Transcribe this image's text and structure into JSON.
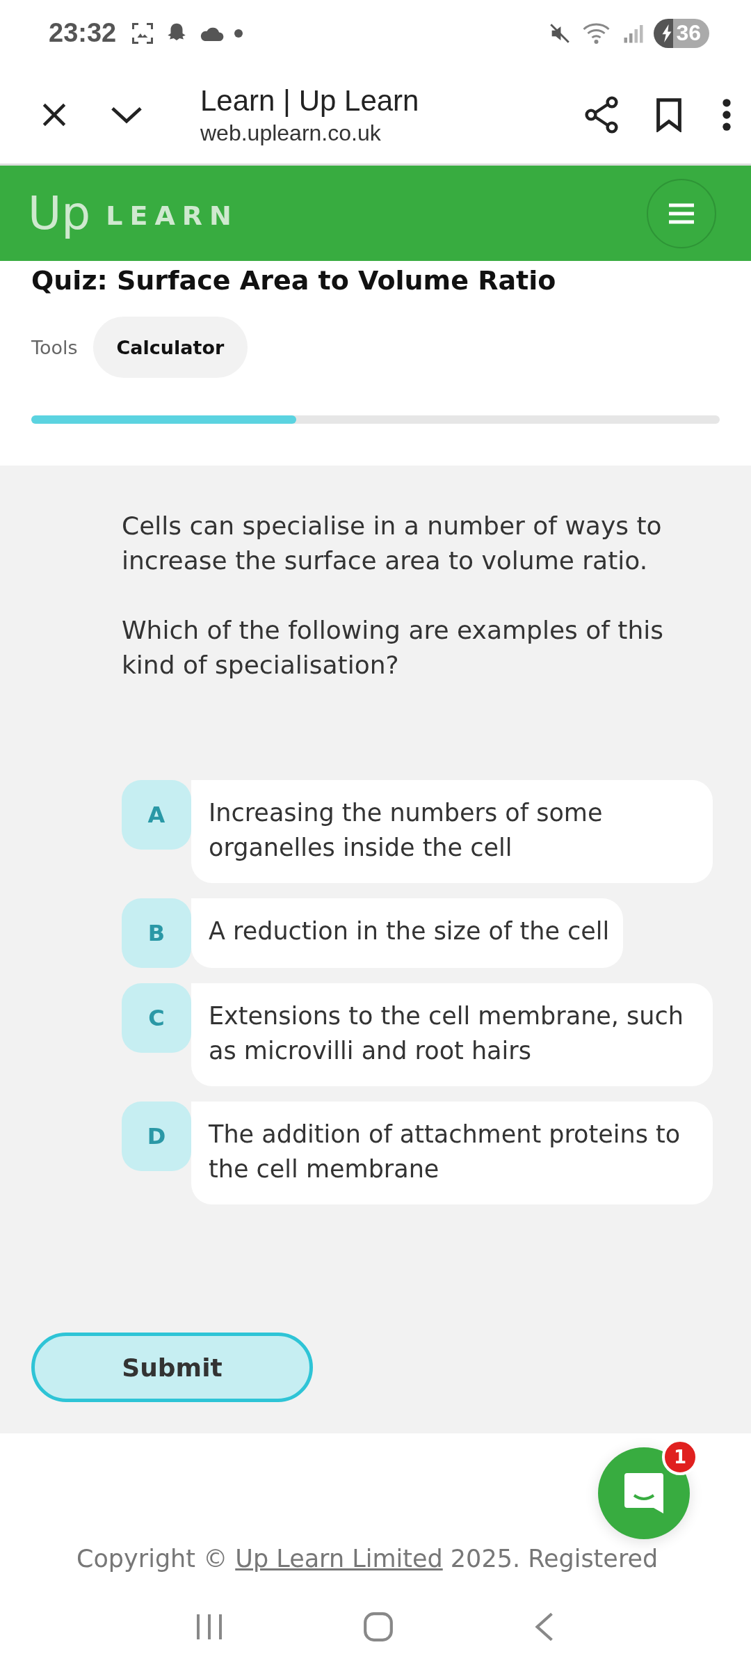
{
  "status_bar": {
    "time": "23:32",
    "battery": "36"
  },
  "browser_bar": {
    "title": "Learn | Up Learn",
    "url": "web.uplearn.co.uk"
  },
  "site_header": {
    "logo_up": "Up",
    "logo_learn": "LEARN"
  },
  "quiz": {
    "title": "Quiz: Surface Area to Volume Ratio",
    "tools_label": "Tools",
    "tools": [
      {
        "label": "Calculator",
        "selected": false
      }
    ],
    "progress": {
      "level": 0.385
    }
  },
  "question": {
    "paragraphs": [
      "Cells can specialise in a number of ways to increase the surface area to volume ratio.",
      "Which of the following are examples of this kind of specialisation?"
    ]
  },
  "options": [
    {
      "letter": "A",
      "text": "Increasing the numbers of some organelles inside the cell",
      "selected": false
    },
    {
      "letter": "B",
      "text": "A reduction in the size of the cell",
      "selected": false
    },
    {
      "letter": "C",
      "text": "Extensions to the cell membrane, such as microvilli and root hairs",
      "selected": false
    },
    {
      "letter": "D",
      "text": "The addition of attachment proteins to the cell membrane",
      "selected": false
    }
  ],
  "submit": {
    "label": "Submit"
  },
  "chat": {
    "badge": "1"
  },
  "footer": {
    "before": "Copyright © ",
    "link": "Up Learn Limited",
    "after": " 2025. Registered"
  }
}
